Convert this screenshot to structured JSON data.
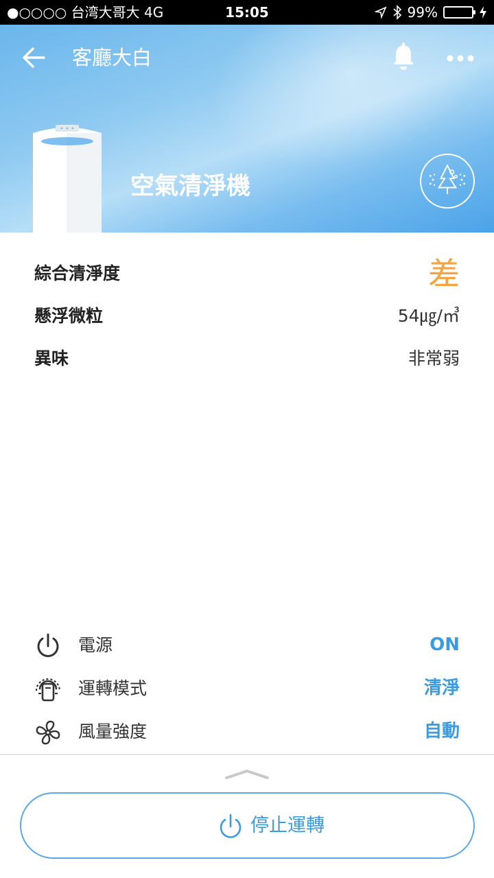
{
  "status_bar": {
    "carrier": "●○○○○ 台湾大哥大  4G",
    "time": "15:05",
    "battery_percent": "99%",
    "battery_level": 0.99
  },
  "header": {
    "title": "客廳大白"
  },
  "hero": {
    "device_name": "空氣清淨機"
  },
  "metrics": [
    {
      "label": "綜合清淨度",
      "value": "差"
    },
    {
      "label": "懸浮微粒",
      "value": "54㎍/㎥"
    },
    {
      "label": "異味",
      "value": "非常弱"
    }
  ],
  "controls": [
    {
      "label": "電源",
      "value": "ON",
      "icon": "power-icon"
    },
    {
      "label": "運轉模式",
      "value": "清淨",
      "icon": "mode-icon"
    },
    {
      "label": "風量強度",
      "value": "自動",
      "icon": "fan-icon"
    }
  ],
  "action": {
    "label": "停止運轉"
  },
  "colors": {
    "accent": "#3a9be0",
    "grade_bad": "#f5a442"
  }
}
